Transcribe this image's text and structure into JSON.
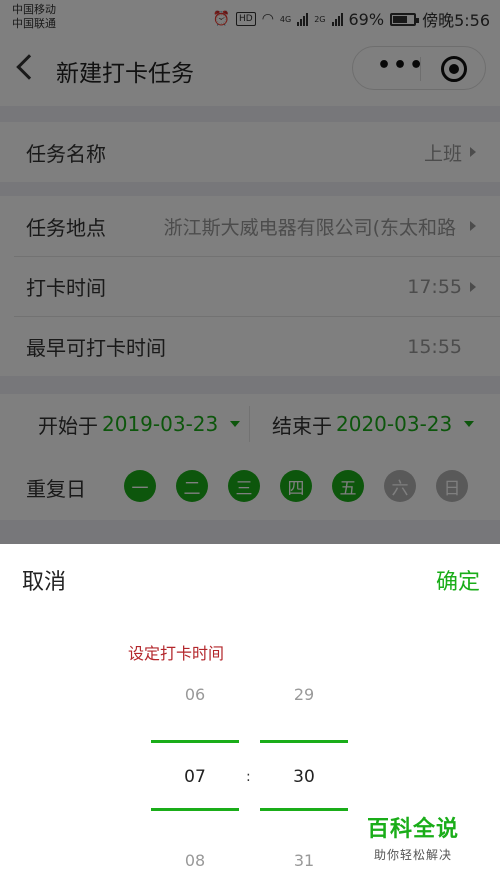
{
  "status_bar": {
    "carrier_1": "中国移动",
    "carrier_2": "中国联通",
    "alarm_icon": "alarm-clock-icon",
    "hd_badge": "HD",
    "wifi_icon": "wifi-icon",
    "net_1": "4G",
    "net_2": "2G",
    "battery": "69%",
    "time": "傍晚5:56"
  },
  "nav": {
    "title": "新建打卡任务",
    "back_icon": "chevron-left-icon",
    "more_icon": "more-dots-icon",
    "close_icon": "target-circle-icon"
  },
  "form": {
    "task_name_label": "任务名称",
    "task_name_value": "上班",
    "location_label": "任务地点",
    "location_value": "浙江斯大威电器有限公司(东太和路",
    "time_label": "打卡时间",
    "time_value": "17:55",
    "earliest_label": "最早可打卡时间",
    "earliest_value": "15:55",
    "start_label": "开始于",
    "start_value": "2019-03-23",
    "end_label": "结束于",
    "end_value": "2020-03-23",
    "repeat_label": "重复日",
    "days": [
      {
        "label": "一",
        "active": true
      },
      {
        "label": "二",
        "active": true
      },
      {
        "label": "三",
        "active": true
      },
      {
        "label": "四",
        "active": true
      },
      {
        "label": "五",
        "active": true
      },
      {
        "label": "六",
        "active": false
      },
      {
        "label": "日",
        "active": false
      }
    ]
  },
  "sheet": {
    "cancel": "取消",
    "confirm": "确定",
    "title": "设定打卡时间",
    "hour_prev": "06",
    "hour_selected": "07",
    "hour_next": "08",
    "separator": ":",
    "minute_prev": "29",
    "minute_selected": "30",
    "minute_next": "31"
  },
  "watermark": {
    "title": "百科全说",
    "subtitle": "助你轻松解决"
  },
  "colors": {
    "accent": "#1aad19",
    "sheet_title": "#b3262b",
    "inactive_day": "#b2b2b2"
  }
}
